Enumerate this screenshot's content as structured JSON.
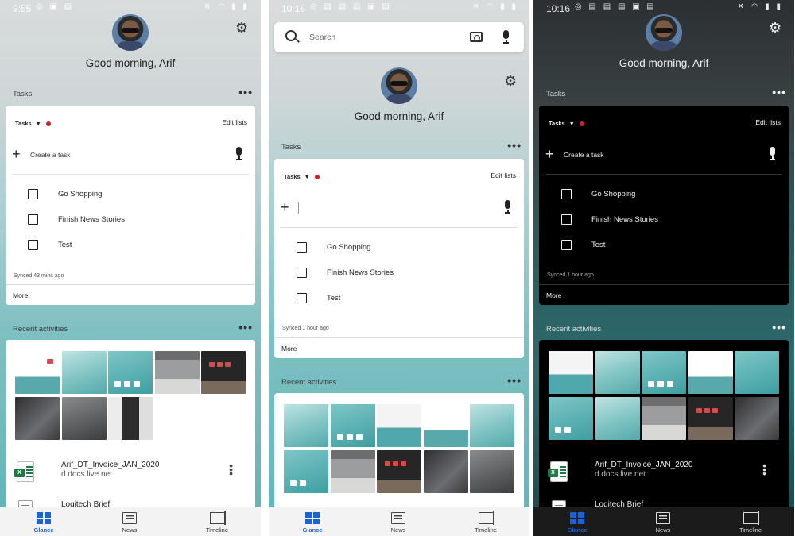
{
  "screens": [
    {
      "theme": "light",
      "status_time": "9:55",
      "greeting": "Good morning, Arif",
      "tasks_section_label": "Tasks",
      "tasks_list_name": "Tasks",
      "edit_lists_label": "Edit lists",
      "create_task_placeholder": "Create a task",
      "tasks": [
        "Go Shopping",
        "Finish News Stories",
        "Test"
      ],
      "synced": "Synced 43 mins ago",
      "more_label": "More",
      "recent_label": "Recent activities",
      "files": [
        {
          "name": "Arif_DT_Invoice_JAN_2020",
          "source": "d.docs.live.net"
        },
        {
          "name": "Logitech Brief"
        }
      ]
    },
    {
      "theme": "light",
      "status_time": "10:16",
      "search_placeholder": "Search",
      "greeting": "Good morning, Arif",
      "tasks_section_label": "Tasks",
      "tasks_list_name": "Tasks",
      "edit_lists_label": "Edit lists",
      "tasks": [
        "Go Shopping",
        "Finish News Stories",
        "Test"
      ],
      "synced": "Synced 1 hour ago",
      "more_label": "More",
      "recent_label": "Recent activities"
    },
    {
      "theme": "dark",
      "status_time": "10:16",
      "greeting": "Good morning, Arif",
      "tasks_section_label": "Tasks",
      "tasks_list_name": "Tasks",
      "edit_lists_label": "Edit lists",
      "create_task_placeholder": "Create a task",
      "tasks": [
        "Go Shopping",
        "Finish News Stories",
        "Test"
      ],
      "synced": "Synced 1 hour ago",
      "more_label": "More",
      "recent_label": "Recent activities",
      "files": [
        {
          "name": "Arif_DT_Invoice_JAN_2020",
          "source": "d.docs.live.net"
        },
        {
          "name": "Logitech Brief"
        }
      ]
    }
  ],
  "bottom_nav": [
    {
      "label": "Glance",
      "icon": "glance-icon",
      "active": true
    },
    {
      "label": "News",
      "icon": "news-icon",
      "active": false
    },
    {
      "label": "Timeline",
      "icon": "timeline-icon",
      "active": false
    }
  ],
  "colors": {
    "accent": "#1a63d6",
    "task_indicator": "#d32020",
    "excel_green": "#1f7a45"
  }
}
